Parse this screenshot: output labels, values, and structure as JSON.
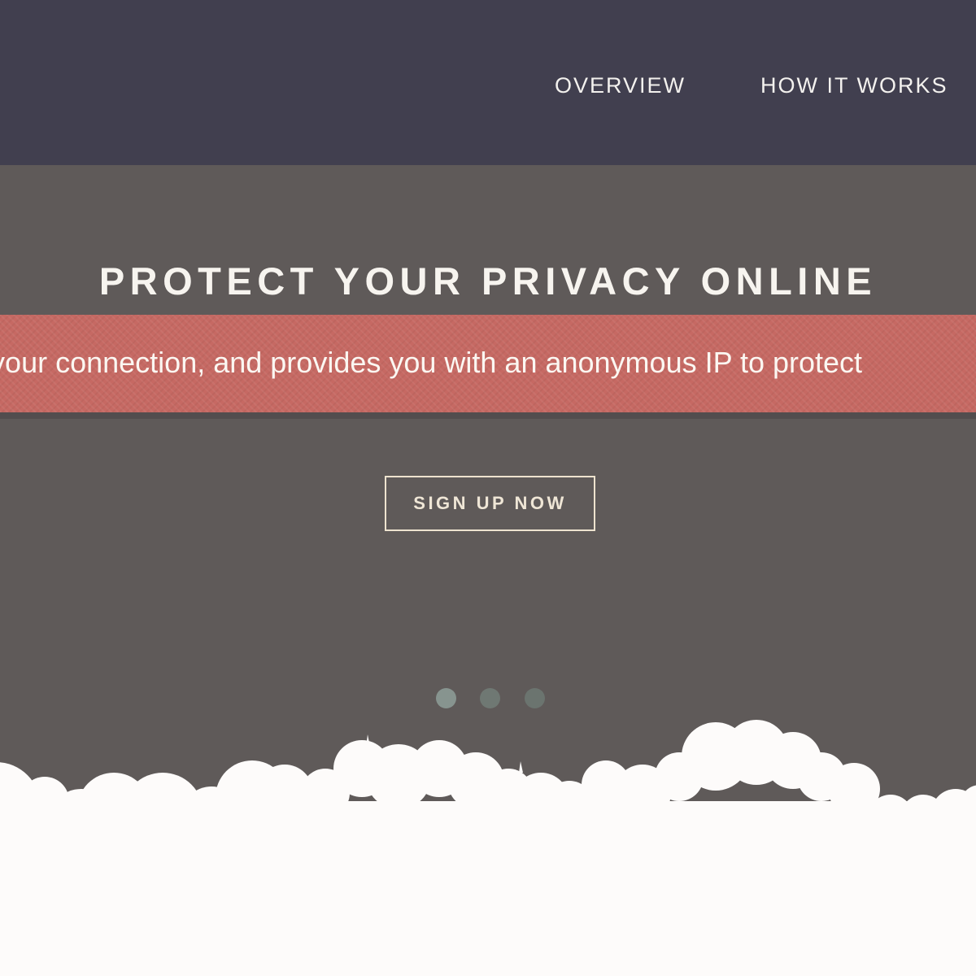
{
  "nav": {
    "items": [
      {
        "label": "OVERVIEW"
      },
      {
        "label": "HOW IT WORKS"
      }
    ]
  },
  "hero": {
    "title": "PROTECT YOUR PRIVACY ONLINE",
    "ribbon_text": "encrypts your connection, and provides you with an anonymous IP to protect",
    "signup_label": "SIGN UP NOW",
    "slider": {
      "count": 3,
      "active_index": 0
    }
  },
  "colors": {
    "nav_bg": "#413f4f",
    "hero_bg": "#5f5a59",
    "ribbon": "#c66963",
    "clouds": "#fdfbfa"
  }
}
